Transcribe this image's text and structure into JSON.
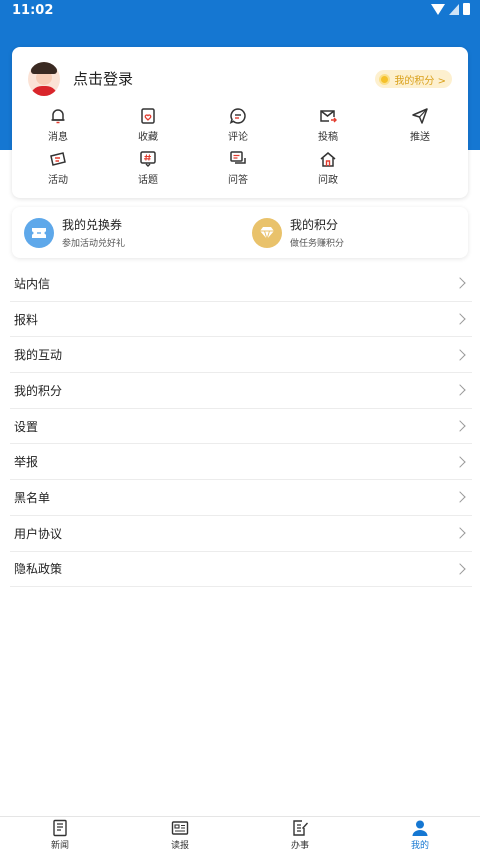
{
  "status": {
    "time": "11:02"
  },
  "profile": {
    "login_text": "点击登录",
    "points_pill": "我的积分 >"
  },
  "grid": [
    {
      "label": "消息",
      "icon": "bell-icon"
    },
    {
      "label": "收藏",
      "icon": "favorite-icon"
    },
    {
      "label": "评论",
      "icon": "comment-icon"
    },
    {
      "label": "投稿",
      "icon": "submit-mail-icon"
    },
    {
      "label": "推送",
      "icon": "send-icon"
    },
    {
      "label": "活动",
      "icon": "ticket-icon"
    },
    {
      "label": "话题",
      "icon": "hashtag-icon"
    },
    {
      "label": "问答",
      "icon": "qa-icon"
    },
    {
      "label": "问政",
      "icon": "government-icon"
    }
  ],
  "promos": {
    "coupon": {
      "title": "我的兑换券",
      "subtitle": "参加活动兑好礼",
      "icon": "coupon-icon",
      "color": "#5ea8ea"
    },
    "points": {
      "title": "我的积分",
      "subtitle": "做任务赚积分",
      "icon": "diamond-icon",
      "color": "#e9c26b"
    }
  },
  "menu": [
    "站内信",
    "报料",
    "我的互动",
    "我的积分",
    "设置",
    "举报",
    "黑名单",
    "用户协议",
    "隐私政策"
  ],
  "tabs": [
    {
      "label": "新闻",
      "icon": "news-icon",
      "active": false
    },
    {
      "label": "读报",
      "icon": "newspaper-icon",
      "active": false
    },
    {
      "label": "办事",
      "icon": "services-icon",
      "active": false
    },
    {
      "label": "我的",
      "icon": "person-icon",
      "active": true
    }
  ],
  "colors": {
    "brand_blue": "#1577d2",
    "accent_red": "#e23c2f",
    "gold": "#d9a01a"
  }
}
